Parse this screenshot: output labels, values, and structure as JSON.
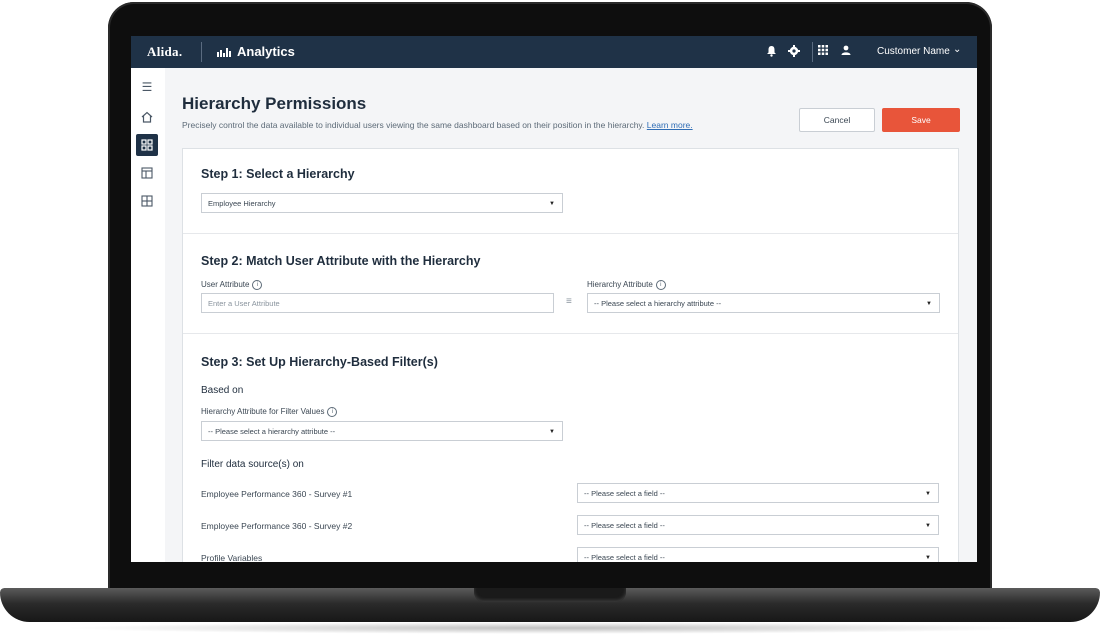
{
  "topbar": {
    "logo": "Alida.",
    "app_name": "Analytics",
    "user_name": "Customer Name"
  },
  "icons": [
    "menu-icon",
    "home-icon",
    "dashboard-icon",
    "table-icon",
    "grid-icon",
    "bell-icon",
    "gear-icon",
    "apps-icon",
    "user-icon",
    "chevron-down-icon"
  ],
  "page": {
    "title": "Hierarchy Permissions",
    "description": "Precisely control the data available to individual users viewing the same dashboard based on their position in the hierarchy.",
    "learn_more": "Learn more.",
    "cancel_label": "Cancel",
    "save_label": "Save"
  },
  "step1": {
    "title": "Step 1: Select a Hierarchy",
    "hierarchy_value": "Employee Hierarchy"
  },
  "step2": {
    "title": "Step 2: Match User Attribute with the Hierarchy",
    "user_attribute_label": "User Attribute",
    "user_attribute_placeholder": "Enter a User Attribute",
    "hierarchy_attribute_label": "Hierarchy Attribute",
    "hierarchy_attribute_value": "-- Please select a hierarchy attribute --"
  },
  "step3": {
    "title": "Step 3: Set Up Hierarchy-Based Filter(s)",
    "based_on": "Based on",
    "filter_values_label": "Hierarchy Attribute for Filter Values",
    "filter_values_value": "-- Please select a hierarchy attribute --",
    "filter_sources_title": "Filter data source(s) on",
    "sources": [
      {
        "label": "Employee Performance 360 - Survey #1",
        "value": "-- Please select a field --"
      },
      {
        "label": "Employee Performance 360 - Survey #2",
        "value": "-- Please select a field --"
      },
      {
        "label": "Profile Variables",
        "value": "-- Please select a field --"
      }
    ]
  },
  "colors": {
    "topbar": "#1f3247",
    "save": "#e8553a",
    "link": "#2f6db5"
  }
}
